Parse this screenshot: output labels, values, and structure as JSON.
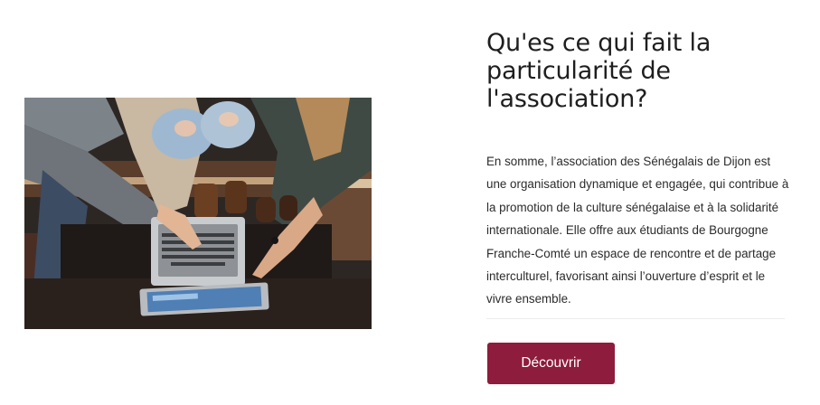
{
  "section": {
    "heading": "Qu'es ce qui fait la particularité de l'association?",
    "description": "En somme, l’association des Sénégalais de Dijon est une organisation dynamique et engagée, qui contribue à la promotion de la culture sénégalaise et à la solidarité internationale. Elle offre aux étudiants de Bourgogne Franche-Comté un espace de rencontre et de partage interculturel, favorisant ainsi l’ouverture d’esprit et le vivre ensemble.",
    "button_label": "Découvrir"
  },
  "colors": {
    "accent": "#8e1c3c",
    "heading": "#1e1e1e",
    "text": "#2b2b2b"
  }
}
